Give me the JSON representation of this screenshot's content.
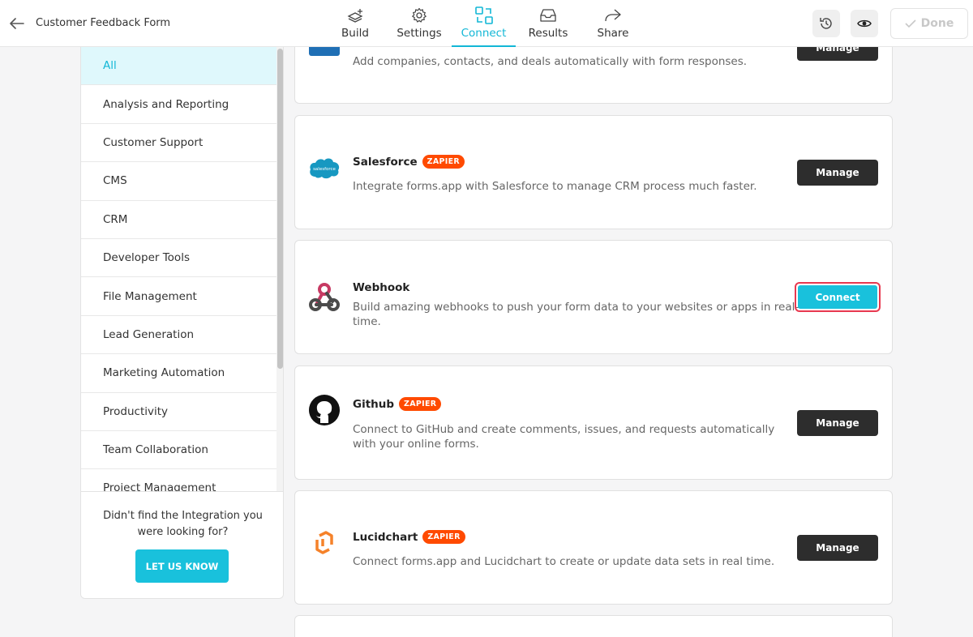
{
  "header": {
    "title": "Customer Feedback Form",
    "tabs": [
      {
        "label": "Build",
        "icon": "build-icon"
      },
      {
        "label": "Settings",
        "icon": "gear-icon"
      },
      {
        "label": "Connect",
        "icon": "connect-icon",
        "active": true
      },
      {
        "label": "Results",
        "icon": "inbox-icon"
      },
      {
        "label": "Share",
        "icon": "share-arrow-icon"
      }
    ],
    "done_label": "Done"
  },
  "sidebar": {
    "categories": [
      "All",
      "Analysis and Reporting",
      "Customer Support",
      "CMS",
      "CRM",
      "Developer Tools",
      "File Management",
      "Lead Generation",
      "Marketing Automation",
      "Productivity",
      "Team Collaboration",
      "Project Management"
    ],
    "active_category": "All",
    "footer_message": "Didn't find the Integration you were looking for?",
    "footer_button": "LET US KNOW"
  },
  "integrations": [
    {
      "name": "",
      "description": "Add companies, contacts, and deals automatically with form responses.",
      "button": "Manage"
    },
    {
      "name": "Salesforce",
      "badge": "ZAPIER",
      "logo_text": "salesforce",
      "description": "Integrate forms.app with Salesforce to manage CRM process much faster.",
      "button": "Manage"
    },
    {
      "name": "Webhook",
      "description": "Build amazing webhooks to push your form data to your websites or apps in real-time.",
      "button": "Connect"
    },
    {
      "name": "Github",
      "badge": "ZAPIER",
      "description": "Connect to GitHub and create comments, issues, and requests automatically with your online forms.",
      "button": "Manage"
    },
    {
      "name": "Lucidchart",
      "badge": "ZAPIER",
      "description": "Connect forms.app and Lucidchart to create or update data sets in real time.",
      "button": "Manage"
    }
  ],
  "colors": {
    "accent": "#12b7d6",
    "button_cyan": "#19c1dc",
    "zapier": "#ff4a00",
    "manage_button": "#2d2d2d",
    "highlight_border": "#e8384f"
  }
}
